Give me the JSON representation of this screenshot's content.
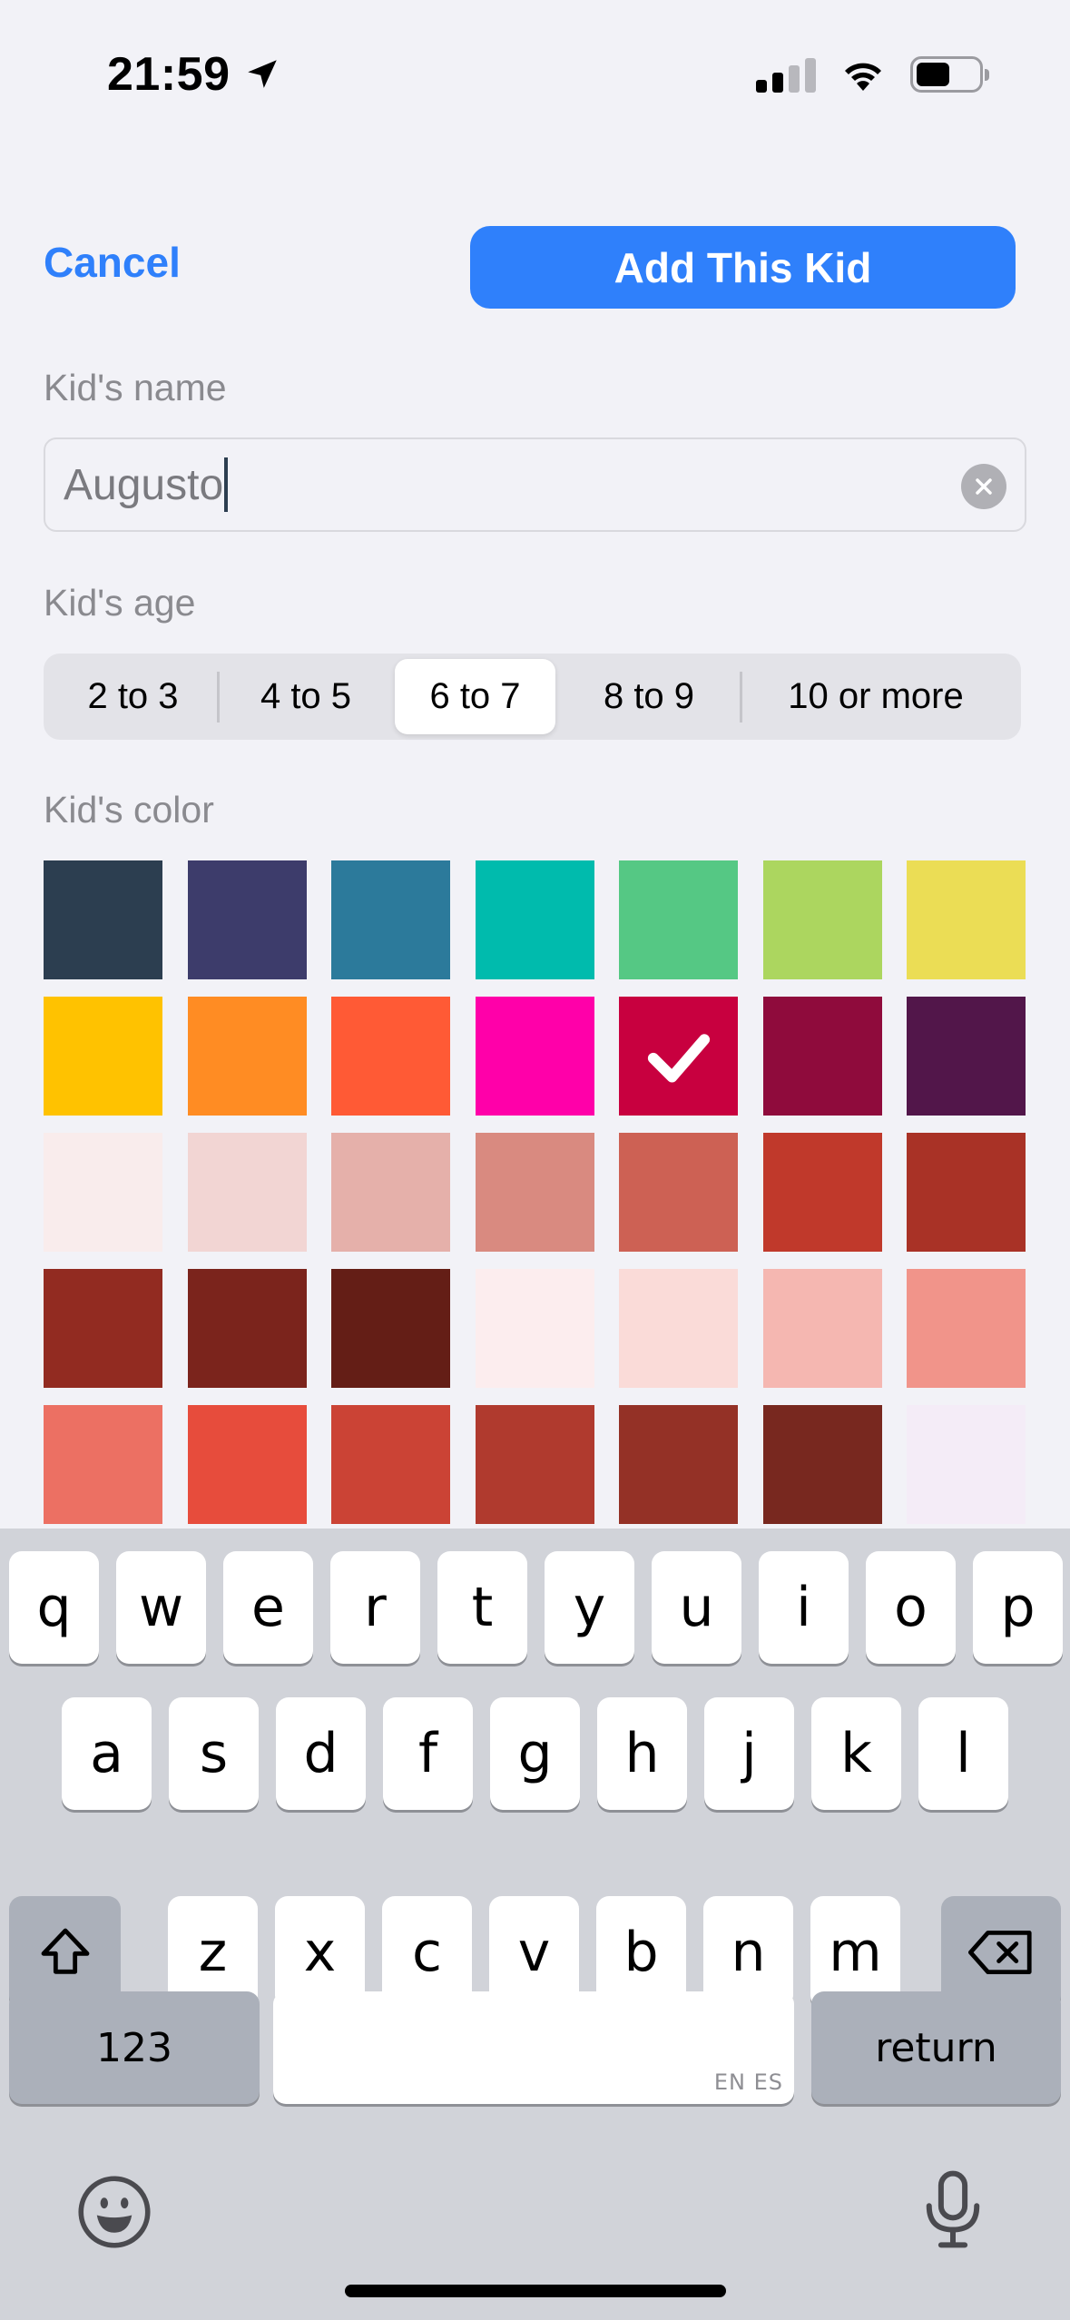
{
  "status_bar": {
    "time": "21:59"
  },
  "header": {
    "cancel_label": "Cancel",
    "add_label": "Add This Kid"
  },
  "name_section": {
    "label": "Kid's name",
    "value": "Augusto"
  },
  "age_section": {
    "label": "Kid's age",
    "options": [
      "2 to 3",
      "4 to 5",
      "6 to 7",
      "8 to 9",
      "10 or more"
    ],
    "selected": "6 to 7"
  },
  "color_section": {
    "label": "Kid's color",
    "selected_color": "#c8003f",
    "colors": [
      "#2c3e50",
      "#3d3c6b",
      "#2c7a9b",
      "#00bbad",
      "#55c884",
      "#acd65f",
      "#ebdd55",
      "#ffc200",
      "#ff8c23",
      "#ff5a35",
      "#ff00a9",
      "#c8003f",
      "#8f0b3c",
      "#52164a",
      "#f9ecec",
      "#f2d5d3",
      "#e5b0aa",
      "#d98a80",
      "#cd6154",
      "#c0392b",
      "#a93226",
      "#922b21",
      "#7b241c",
      "#641e16",
      "#fcedee",
      "#fadbd8",
      "#f5b7b1",
      "#f1948a",
      "#ec7063",
      "#e74c3c",
      "#cb4335",
      "#b03a2e",
      "#943126",
      "#78281f",
      "#f4ecf7"
    ]
  },
  "keyboard": {
    "row1": [
      "q",
      "w",
      "e",
      "r",
      "t",
      "y",
      "u",
      "i",
      "o",
      "p"
    ],
    "row2": [
      "a",
      "s",
      "d",
      "f",
      "g",
      "h",
      "j",
      "k",
      "l"
    ],
    "row3": [
      "z",
      "x",
      "c",
      "v",
      "b",
      "n",
      "m"
    ],
    "numbers_label": "123",
    "return_label": "return",
    "language_label": "EN ES"
  }
}
